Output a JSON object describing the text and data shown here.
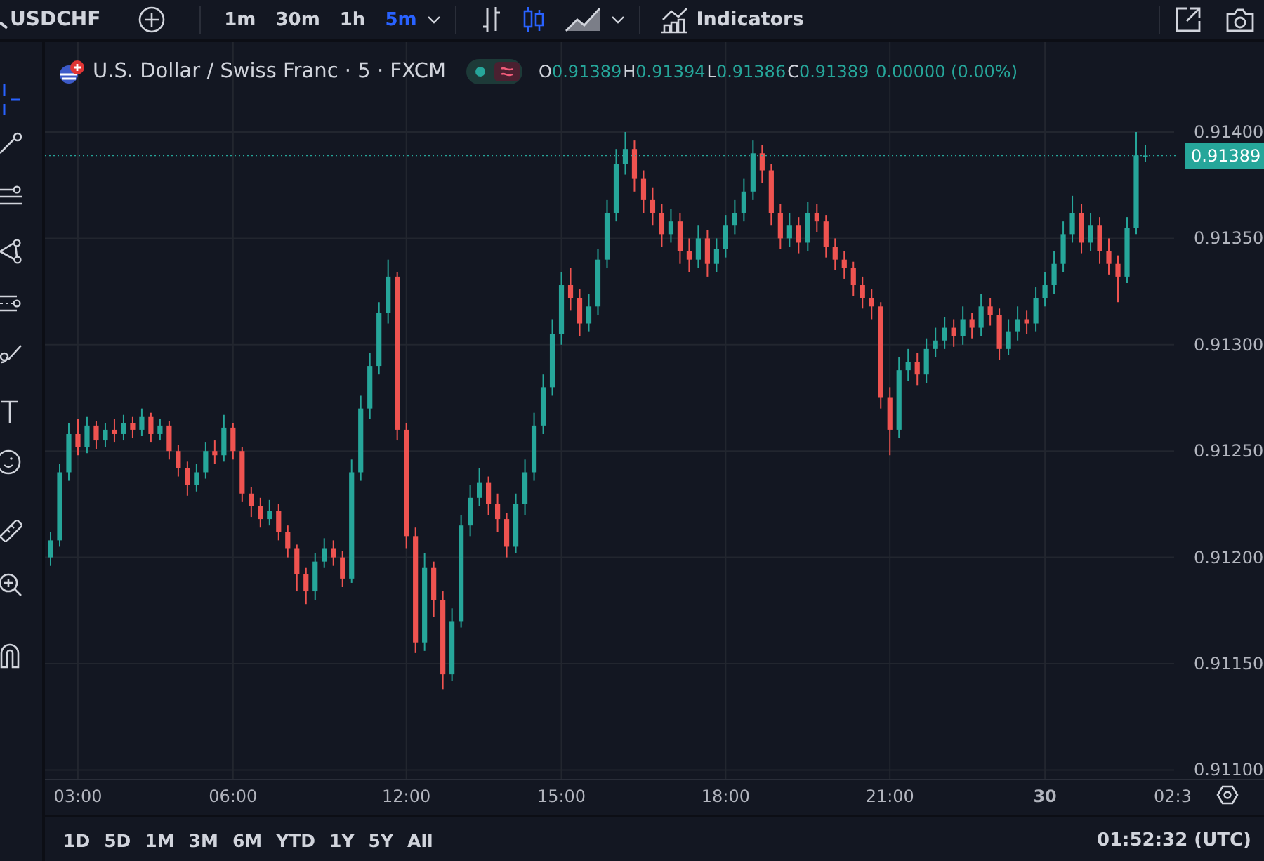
{
  "top_toolbar": {
    "symbol": "USDCHF",
    "intervals": [
      {
        "label": "1m",
        "selected": false
      },
      {
        "label": "30m",
        "selected": false
      },
      {
        "label": "1h",
        "selected": false
      },
      {
        "label": "5m",
        "selected": true
      }
    ],
    "chart_types": [
      {
        "selected": false
      },
      {
        "selected": true
      },
      {
        "selected": false
      }
    ],
    "indicators_label": "Indicators"
  },
  "drawing_tools": [
    {
      "selected": true
    },
    {
      "selected": false
    },
    {
      "selected": false
    },
    {
      "selected": false
    },
    {
      "selected": false
    },
    {
      "selected": false
    },
    {
      "selected": false
    },
    {
      "selected": false
    },
    {
      "selected": false
    },
    {
      "selected": false
    },
    {
      "selected": false
    }
  ],
  "legend": {
    "title": "U.S. Dollar / Swiss Franc · 5 · FXCM",
    "ohlc": [
      {
        "label": "O",
        "value": "0.91389"
      },
      {
        "label": "H",
        "value": "0.91394"
      },
      {
        "label": "L",
        "value": "0.91386"
      },
      {
        "label": "C",
        "value": "0.91389"
      }
    ],
    "change": "0.00000 (0.00%)"
  },
  "chart": {
    "chart_data": {
      "type": "candlestick",
      "grid": true,
      "ylim": [
        0.911,
        0.914
      ],
      "ref_lines": [
        {
          "axis": "y",
          "value": 0.91389,
          "label": "0.91389",
          "color": "#26a69a"
        }
      ],
      "yticks": [
        {
          "value": 0.914,
          "label": "0.91400"
        },
        {
          "value": 0.9135,
          "label": "0.91350"
        },
        {
          "value": 0.913,
          "label": "0.91300"
        },
        {
          "value": 0.9125,
          "label": "0.91250"
        },
        {
          "value": 0.912,
          "label": "0.91200"
        },
        {
          "value": 0.9115,
          "label": "0.91150"
        },
        {
          "value": 0.911,
          "label": "0.91100"
        }
      ],
      "ohlc": [
        [
          0.912,
          0.91212,
          0.91196,
          0.91208
        ],
        [
          0.91208,
          0.91244,
          0.91205,
          0.9124
        ],
        [
          0.9124,
          0.91263,
          0.91236,
          0.91258
        ],
        [
          0.91258,
          0.91265,
          0.91248,
          0.91252
        ],
        [
          0.91252,
          0.91266,
          0.91249,
          0.91262
        ],
        [
          0.91262,
          0.91264,
          0.91251,
          0.91255
        ],
        [
          0.91255,
          0.91263,
          0.91252,
          0.9126
        ],
        [
          0.9126,
          0.91265,
          0.91254,
          0.91258
        ],
        [
          0.91258,
          0.91267,
          0.91255,
          0.91263
        ],
        [
          0.91263,
          0.91266,
          0.91256,
          0.9126
        ],
        [
          0.9126,
          0.9127,
          0.91257,
          0.91266
        ],
        [
          0.91266,
          0.91268,
          0.91254,
          0.91258
        ],
        [
          0.91258,
          0.91265,
          0.91255,
          0.91262
        ],
        [
          0.91262,
          0.91264,
          0.91246,
          0.9125
        ],
        [
          0.9125,
          0.91253,
          0.91238,
          0.91242
        ],
        [
          0.91242,
          0.91245,
          0.91229,
          0.91234
        ],
        [
          0.91234,
          0.91244,
          0.91231,
          0.9124
        ],
        [
          0.9124,
          0.91254,
          0.91237,
          0.9125
        ],
        [
          0.9125,
          0.91255,
          0.91244,
          0.91248
        ],
        [
          0.91248,
          0.91267,
          0.91245,
          0.91261
        ],
        [
          0.91261,
          0.91263,
          0.91246,
          0.9125
        ],
        [
          0.9125,
          0.91252,
          0.91226,
          0.9123
        ],
        [
          0.9123,
          0.91233,
          0.91219,
          0.91224
        ],
        [
          0.91224,
          0.91228,
          0.91214,
          0.91218
        ],
        [
          0.91218,
          0.91227,
          0.91215,
          0.91222
        ],
        [
          0.91222,
          0.91225,
          0.91208,
          0.91212
        ],
        [
          0.91212,
          0.91215,
          0.912,
          0.91204
        ],
        [
          0.91204,
          0.91206,
          0.91184,
          0.91192
        ],
        [
          0.91192,
          0.91195,
          0.91178,
          0.91184
        ],
        [
          0.91184,
          0.91202,
          0.9118,
          0.91198
        ],
        [
          0.91198,
          0.91209,
          0.91195,
          0.91204
        ],
        [
          0.91204,
          0.91208,
          0.91196,
          0.912
        ],
        [
          0.912,
          0.91203,
          0.91186,
          0.9119
        ],
        [
          0.9119,
          0.91246,
          0.91188,
          0.9124
        ],
        [
          0.9124,
          0.91276,
          0.91236,
          0.9127
        ],
        [
          0.9127,
          0.91296,
          0.91265,
          0.9129
        ],
        [
          0.9129,
          0.9132,
          0.91286,
          0.91315
        ],
        [
          0.91315,
          0.9134,
          0.9131,
          0.91332
        ],
        [
          0.91332,
          0.91334,
          0.91255,
          0.9126
        ],
        [
          0.9126,
          0.91263,
          0.91204,
          0.9121
        ],
        [
          0.9121,
          0.91214,
          0.91155,
          0.9116
        ],
        [
          0.9116,
          0.91202,
          0.91156,
          0.91195
        ],
        [
          0.91195,
          0.91198,
          0.91172,
          0.9118
        ],
        [
          0.9118,
          0.91184,
          0.91138,
          0.91145
        ],
        [
          0.91145,
          0.91176,
          0.91142,
          0.9117
        ],
        [
          0.9117,
          0.9122,
          0.91167,
          0.91215
        ],
        [
          0.91215,
          0.91234,
          0.9121,
          0.91228
        ],
        [
          0.91228,
          0.91242,
          0.91224,
          0.91235
        ],
        [
          0.91235,
          0.91238,
          0.9122,
          0.91225
        ],
        [
          0.91225,
          0.9123,
          0.91212,
          0.91218
        ],
        [
          0.91218,
          0.91221,
          0.912,
          0.91205
        ],
        [
          0.91205,
          0.9123,
          0.91202,
          0.91225
        ],
        [
          0.91225,
          0.91246,
          0.9122,
          0.9124
        ],
        [
          0.9124,
          0.91268,
          0.91236,
          0.91262
        ],
        [
          0.91262,
          0.91286,
          0.91258,
          0.9128
        ],
        [
          0.9128,
          0.91312,
          0.91276,
          0.91305
        ],
        [
          0.91305,
          0.91334,
          0.913,
          0.91328
        ],
        [
          0.91328,
          0.91336,
          0.91316,
          0.91322
        ],
        [
          0.91322,
          0.91326,
          0.91304,
          0.9131
        ],
        [
          0.9131,
          0.91324,
          0.91306,
          0.91318
        ],
        [
          0.91318,
          0.91345,
          0.91314,
          0.9134
        ],
        [
          0.9134,
          0.91368,
          0.91336,
          0.91362
        ],
        [
          0.91362,
          0.91392,
          0.91358,
          0.91385
        ],
        [
          0.91385,
          0.914,
          0.9138,
          0.91392
        ],
        [
          0.91392,
          0.91396,
          0.91372,
          0.91378
        ],
        [
          0.91378,
          0.91382,
          0.91362,
          0.91368
        ],
        [
          0.91368,
          0.91374,
          0.91356,
          0.91362
        ],
        [
          0.91362,
          0.91366,
          0.91346,
          0.91352
        ],
        [
          0.91352,
          0.91364,
          0.91348,
          0.91358
        ],
        [
          0.91358,
          0.91362,
          0.91338,
          0.91344
        ],
        [
          0.91344,
          0.9135,
          0.91334,
          0.9134
        ],
        [
          0.9134,
          0.91356,
          0.91336,
          0.9135
        ],
        [
          0.9135,
          0.91354,
          0.91332,
          0.91338
        ],
        [
          0.91338,
          0.9135,
          0.91334,
          0.91345
        ],
        [
          0.91345,
          0.91361,
          0.91341,
          0.91356
        ],
        [
          0.91356,
          0.91368,
          0.91352,
          0.91362
        ],
        [
          0.91362,
          0.91378,
          0.91358,
          0.91372
        ],
        [
          0.91372,
          0.91396,
          0.91368,
          0.9139
        ],
        [
          0.9139,
          0.91394,
          0.91376,
          0.91382
        ],
        [
          0.91382,
          0.91385,
          0.91356,
          0.91362
        ],
        [
          0.91362,
          0.91366,
          0.91345,
          0.9135
        ],
        [
          0.9135,
          0.91362,
          0.91346,
          0.91356
        ],
        [
          0.91356,
          0.9136,
          0.91343,
          0.91348
        ],
        [
          0.91348,
          0.91367,
          0.91344,
          0.91362
        ],
        [
          0.91362,
          0.91366,
          0.91353,
          0.91358
        ],
        [
          0.91358,
          0.91361,
          0.91341,
          0.91346
        ],
        [
          0.91346,
          0.9135,
          0.91335,
          0.9134
        ],
        [
          0.9134,
          0.91344,
          0.91331,
          0.91336
        ],
        [
          0.91336,
          0.91339,
          0.91323,
          0.91328
        ],
        [
          0.91328,
          0.91332,
          0.91317,
          0.91322
        ],
        [
          0.91322,
          0.91326,
          0.91312,
          0.91318
        ],
        [
          0.91318,
          0.9132,
          0.9127,
          0.91275
        ],
        [
          0.91275,
          0.9128,
          0.91248,
          0.9126
        ],
        [
          0.9126,
          0.91294,
          0.91256,
          0.91288
        ],
        [
          0.91288,
          0.91298,
          0.91283,
          0.91292
        ],
        [
          0.91292,
          0.91296,
          0.91281,
          0.91286
        ],
        [
          0.91286,
          0.91303,
          0.91282,
          0.91298
        ],
        [
          0.91298,
          0.91308,
          0.91294,
          0.91302
        ],
        [
          0.91302,
          0.91313,
          0.91298,
          0.91308
        ],
        [
          0.91308,
          0.91312,
          0.91299,
          0.91304
        ],
        [
          0.91304,
          0.91318,
          0.913,
          0.91312
        ],
        [
          0.91312,
          0.91315,
          0.91303,
          0.91308
        ],
        [
          0.91308,
          0.91324,
          0.91304,
          0.91318
        ],
        [
          0.91318,
          0.91322,
          0.91309,
          0.91314
        ],
        [
          0.91314,
          0.91317,
          0.91293,
          0.91298
        ],
        [
          0.91298,
          0.91312,
          0.91295,
          0.91306
        ],
        [
          0.91306,
          0.91318,
          0.91302,
          0.91312
        ],
        [
          0.91312,
          0.91316,
          0.91305,
          0.9131
        ],
        [
          0.9131,
          0.91327,
          0.91306,
          0.91322
        ],
        [
          0.91322,
          0.91334,
          0.91318,
          0.91328
        ],
        [
          0.91328,
          0.91344,
          0.91324,
          0.91338
        ],
        [
          0.91338,
          0.91358,
          0.91334,
          0.91352
        ],
        [
          0.91352,
          0.9137,
          0.91348,
          0.91362
        ],
        [
          0.91362,
          0.91366,
          0.91343,
          0.91348
        ],
        [
          0.91348,
          0.91362,
          0.91344,
          0.91356
        ],
        [
          0.91356,
          0.9136,
          0.91338,
          0.91344
        ],
        [
          0.91344,
          0.9135,
          0.91333,
          0.91338
        ],
        [
          0.91338,
          0.91342,
          0.9132,
          0.91332
        ],
        [
          0.91332,
          0.9136,
          0.91329,
          0.91355
        ],
        [
          0.91355,
          0.914,
          0.91352,
          0.91389
        ],
        [
          0.91389,
          0.91394,
          0.91386,
          0.91389
        ]
      ]
    },
    "time_axis": [
      "03:00",
      "06:00",
      "12:00",
      "15:00",
      "18:00",
      "21:00",
      "30",
      "02:3"
    ]
  },
  "bottom_bar": {
    "ranges": [
      "1D",
      "5D",
      "1M",
      "3M",
      "6M",
      "YTD",
      "1Y",
      "5Y",
      "All"
    ],
    "clock": "01:52:32 (UTC)"
  }
}
